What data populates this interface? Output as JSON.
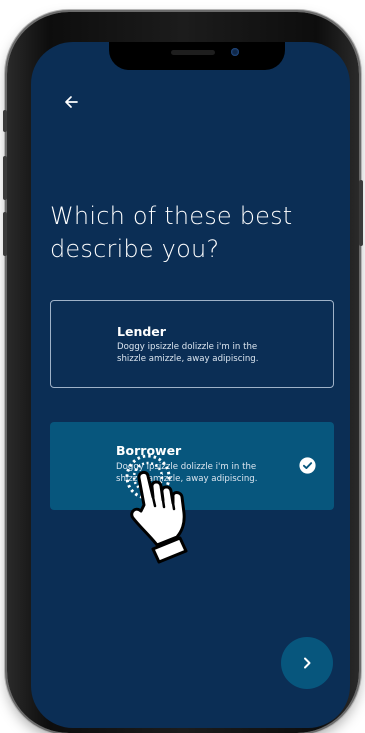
{
  "screen": {
    "title": "Which of these best describe you?",
    "background_color": "#0b2e55",
    "accent_color": "#07567d",
    "back_icon": "arrow-left-icon"
  },
  "options": [
    {
      "title": "Lender",
      "description": "Doggy ipsizzle dolizzle i'm in the shizzle amizzle, away adipiscing.",
      "selected": false
    },
    {
      "title": "Borrower",
      "description": "Doggy ipsizzle dolizzle i'm in the shizzle amizzle, away adipiscing.",
      "selected": true,
      "selected_icon": "check-circle-icon"
    }
  ],
  "next_button": {
    "icon": "chevron-right-icon"
  },
  "overlay": {
    "icon": "tap-hand-icon"
  }
}
